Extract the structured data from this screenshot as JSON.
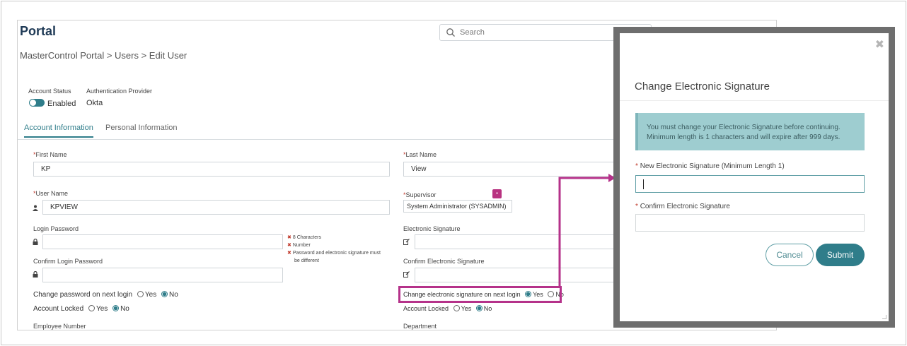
{
  "app": {
    "brand": "Portal",
    "search_placeholder": "Search"
  },
  "breadcrumb": "MasterControl Portal > Users > Edit User",
  "account": {
    "status_label": "Account Status",
    "status_value": "Enabled",
    "auth_label": "Authentication Provider",
    "auth_value": "Okta"
  },
  "tabs": [
    "Account Information",
    "Personal Information"
  ],
  "form": {
    "first_name_label": "First Name",
    "first_name_value": "KP",
    "last_name_label": "Last Name",
    "last_name_value": "View",
    "user_name_label": "User Name",
    "user_name_value": "KPVIEW",
    "supervisor_label": "Supervisor",
    "supervisor_value": "System Administrator (SYSADMIN)",
    "supervisor_remove": "-",
    "login_password_label": "Login Password",
    "confirm_login_password_label": "Confirm Login Password",
    "password_rules": [
      "8 Characters",
      "Number",
      "Password and electronic signature must",
      "be different"
    ],
    "esig_label": "Electronic Signature",
    "confirm_esig_label": "Confirm Electronic Signature",
    "change_password_label": "Change password on next login",
    "change_esig_label": "Change electronic signature on next login",
    "account_locked_label": "Account Locked",
    "yes": "Yes",
    "no": "No",
    "employee_number_label": "Employee Number",
    "department_label": "Department",
    "required_mark": "*"
  },
  "modal": {
    "close": "✖",
    "title": "Change Electronic Signature",
    "alert_line1": "You must change your Electronic Signature before continuing.",
    "alert_line2": "Minimum length is 1 characters and will expire after 999 days.",
    "new_esig_label": "New Electronic Signature (Minimum Length 1)",
    "confirm_esig_label": "Confirm Electronic Signature",
    "cancel": "Cancel",
    "submit": "Submit"
  },
  "colors": {
    "accent": "#2f7d8a",
    "highlight": "#b5328a",
    "required": "#c0392b",
    "alert_bg": "#9ecdd0"
  },
  "icons": [
    "search-icon",
    "user-icon",
    "lock-icon",
    "edit-icon",
    "close-icon",
    "x-mark-icon"
  ]
}
